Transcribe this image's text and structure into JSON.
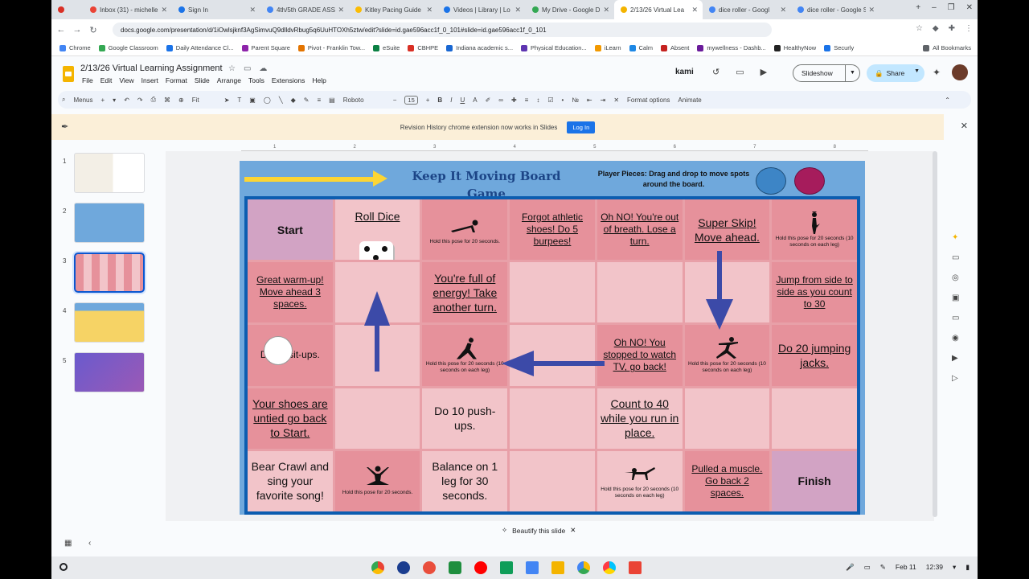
{
  "tabs": [
    {
      "title": "",
      "color": "#d93025"
    },
    {
      "title": "Inbox (31) - michelle",
      "color": "#ea4335"
    },
    {
      "title": "Sign In",
      "color": "#1a73e8"
    },
    {
      "title": "4th/5th GRADE ASSI",
      "color": "#4285f4"
    },
    {
      "title": "Kitley Pacing Guide",
      "color": "#fbbc04"
    },
    {
      "title": "Videos | Library | Lo",
      "color": "#1a73e8"
    },
    {
      "title": "My Drive - Google D",
      "color": "#34a853"
    },
    {
      "title": "2/13/26 Virtual Lea",
      "color": "#f4b400"
    },
    {
      "title": "dice roller - Googl",
      "color": "#4285f4"
    },
    {
      "title": "dice roller - Google S",
      "color": "#4285f4"
    }
  ],
  "url": "docs.google.com/presentation/d/1iOwlsjknf3AgSimvuQ9dlldvRbug5q6UuHTOXh5ztw/edit?slide=id.gae596acc1f_0_101#slide=id.gae596acc1f_0_101",
  "bookmarks": [
    "Chrome",
    "Google Classroom",
    "Daily Attendance Cl...",
    "Parent Square",
    "Pivot - Franklin Tow...",
    "eSuite",
    "CBHPE",
    "Indiana academic s...",
    "Physical Education...",
    "iLearn",
    "Calm",
    "Absent",
    "mywellness - Dashb...",
    "HealthyNow",
    "Securly",
    "All Bookmarks"
  ],
  "doc": {
    "title": "2/13/26 Virtual Learning Assignment",
    "menus": [
      "File",
      "Edit",
      "View",
      "Insert",
      "Format",
      "Slide",
      "Arrange",
      "Tools",
      "Extensions",
      "Help"
    ],
    "kami": "kami",
    "slideshow": "Slideshow",
    "share": "Share"
  },
  "toolbar": {
    "menus": "Menus",
    "zoom": "Fit",
    "font": "Roboto",
    "size": "15",
    "format_options": "Format options",
    "animate": "Animate"
  },
  "notice": {
    "text": "Revision History chrome extension now works in Slides",
    "login": "Log In"
  },
  "filmstrip": [
    "1",
    "2",
    "3",
    "4",
    "5"
  ],
  "ruler": [
    "1",
    "2",
    "3",
    "4",
    "5",
    "6",
    "7",
    "8"
  ],
  "slide": {
    "title": "Keep It Moving Board Game",
    "pieces": "Player Pieces: Drag and drop to move spots around the board.",
    "cells": [
      {
        "t": "Start",
        "c": "c-mauve",
        "s": "big b"
      },
      {
        "t": "Roll Dice",
        "c": "c-light",
        "s": "big u",
        "die": true
      },
      {
        "t": "",
        "c": "c-dark",
        "cap": "Hold this pose for 20 seconds.",
        "sil": "plank"
      },
      {
        "t": "Forgot athletic shoes! Do 5 burpees!",
        "c": "c-dark",
        "s": "u"
      },
      {
        "t": "Oh NO! You're out of breath. Lose a turn.",
        "c": "c-dark",
        "s": "u"
      },
      {
        "t": "Super Skip! Move ahead.",
        "c": "c-dark",
        "s": "big u"
      },
      {
        "t": "",
        "c": "c-dark",
        "cap": "Hold this pose for 20 seconds (10 seconds on each leg)",
        "sil": "tree"
      },
      {
        "t": "Great warm-up! Move ahead 3 spaces.",
        "c": "c-dark",
        "s": "u"
      },
      {
        "t": "",
        "c": "c-light"
      },
      {
        "t": "You're full of energy! Take another turn.",
        "c": "c-dark",
        "s": "big u"
      },
      {
        "t": "",
        "c": "c-light"
      },
      {
        "t": "",
        "c": "c-light"
      },
      {
        "t": "",
        "c": "c-light"
      },
      {
        "t": "Jump from side to side as you count to 30",
        "c": "c-dark",
        "s": "u"
      },
      {
        "t": "Do 10 sit-ups.",
        "c": "c-dark",
        "s": "",
        "dot": true
      },
      {
        "t": "",
        "c": "c-light"
      },
      {
        "t": "",
        "c": "c-dark",
        "cap": "Hold this pose for 20 seconds (10 seconds on each leg)",
        "sil": "triangle"
      },
      {
        "t": "",
        "c": "c-light"
      },
      {
        "t": "Oh NO! You stopped to watch TV, go back!",
        "c": "c-dark",
        "s": "u"
      },
      {
        "t": "",
        "c": "c-dark",
        "cap": "Hold this pose for 20 seconds (10 seconds on each leg)",
        "sil": "warrior"
      },
      {
        "t": "Do 20 jumping jacks.",
        "c": "c-dark",
        "s": "big u"
      },
      {
        "t": "Your shoes are untied go back to Start.",
        "c": "c-dark",
        "s": "big u"
      },
      {
        "t": "",
        "c": "c-light"
      },
      {
        "t": "Do 10 push-ups.",
        "c": "c-light",
        "s": "big"
      },
      {
        "t": "",
        "c": "c-light"
      },
      {
        "t": "Count to 40 while you run in place.",
        "c": "c-light",
        "s": "big u"
      },
      {
        "t": "",
        "c": "c-light"
      },
      {
        "t": "",
        "c": "c-light"
      },
      {
        "t": "Bear Crawl and sing your favorite song!",
        "c": "c-light",
        "s": "big"
      },
      {
        "t": "",
        "c": "c-dark",
        "cap": "Hold this pose for 20 seconds.",
        "sil": "lotus"
      },
      {
        "t": "Balance on 1 leg for 30 seconds.",
        "c": "c-light",
        "s": "big"
      },
      {
        "t": "",
        "c": "c-light"
      },
      {
        "t": "",
        "c": "c-light",
        "cap": "Hold this pose for 20 seconds (10 seconds on each leg)",
        "sil": "bird"
      },
      {
        "t": "Pulled a muscle.  Go back 2 spaces.",
        "c": "c-dark",
        "s": "u"
      },
      {
        "t": "Finish",
        "c": "c-mauve",
        "s": "big b"
      }
    ]
  },
  "beautify": "Beautify this slide",
  "tray": {
    "date": "Feb 11",
    "time": "12:39"
  },
  "colors": {
    "accent": "#0b57d0",
    "board_border": "#0c5db0",
    "arrow": "#3c4aa8"
  }
}
